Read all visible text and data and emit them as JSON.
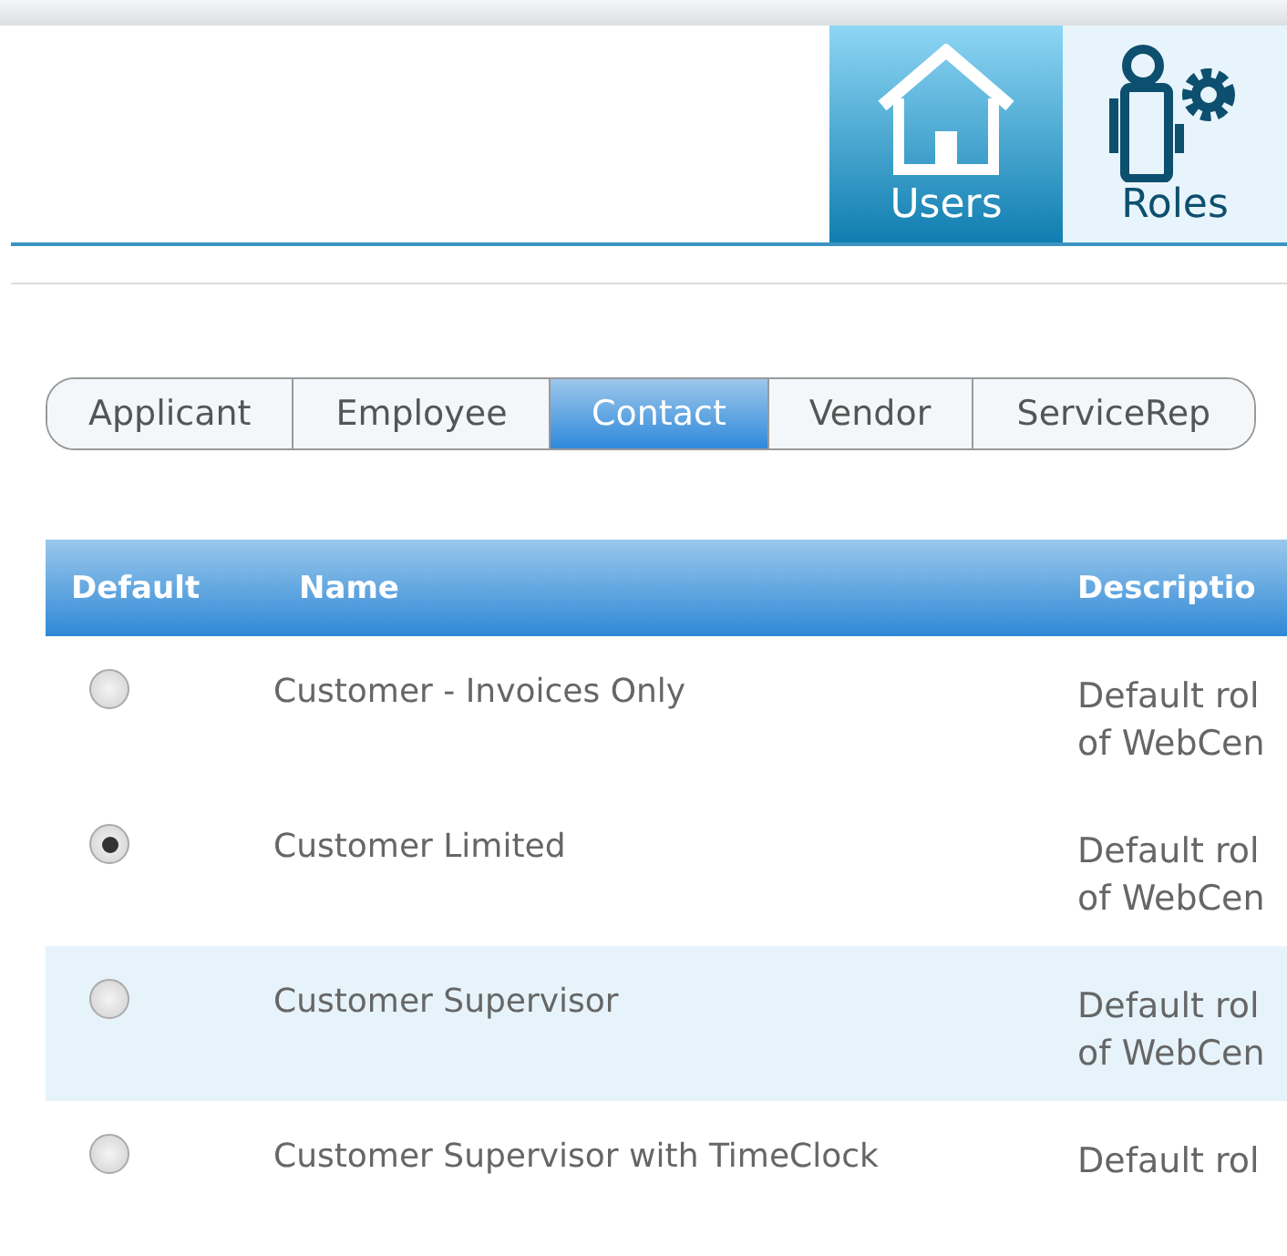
{
  "nav": [
    {
      "label": "Users",
      "kind": "home",
      "selected": true
    },
    {
      "label": "Roles",
      "kind": "roles",
      "selected": false
    }
  ],
  "tabs": [
    {
      "label": "Applicant",
      "selected": false
    },
    {
      "label": "Employee",
      "selected": false
    },
    {
      "label": "Contact",
      "selected": true
    },
    {
      "label": "Vendor",
      "selected": false
    },
    {
      "label": "ServiceRep",
      "selected": false
    }
  ],
  "table": {
    "columns": [
      "Default",
      "Name",
      "Descriptio"
    ],
    "rows": [
      {
        "default": false,
        "highlighted": false,
        "name": "Customer - Invoices Only",
        "description": [
          "Default rol",
          "of WebCen"
        ]
      },
      {
        "default": true,
        "highlighted": false,
        "name": "Customer Limited",
        "description": [
          "Default rol",
          "of WebCen"
        ]
      },
      {
        "default": false,
        "highlighted": true,
        "name": "Customer Supervisor",
        "description": [
          "Default rol",
          "of WebCen"
        ]
      },
      {
        "default": false,
        "highlighted": false,
        "name": "Customer Supervisor with TimeClock",
        "description": [
          "Default rol"
        ]
      }
    ]
  }
}
